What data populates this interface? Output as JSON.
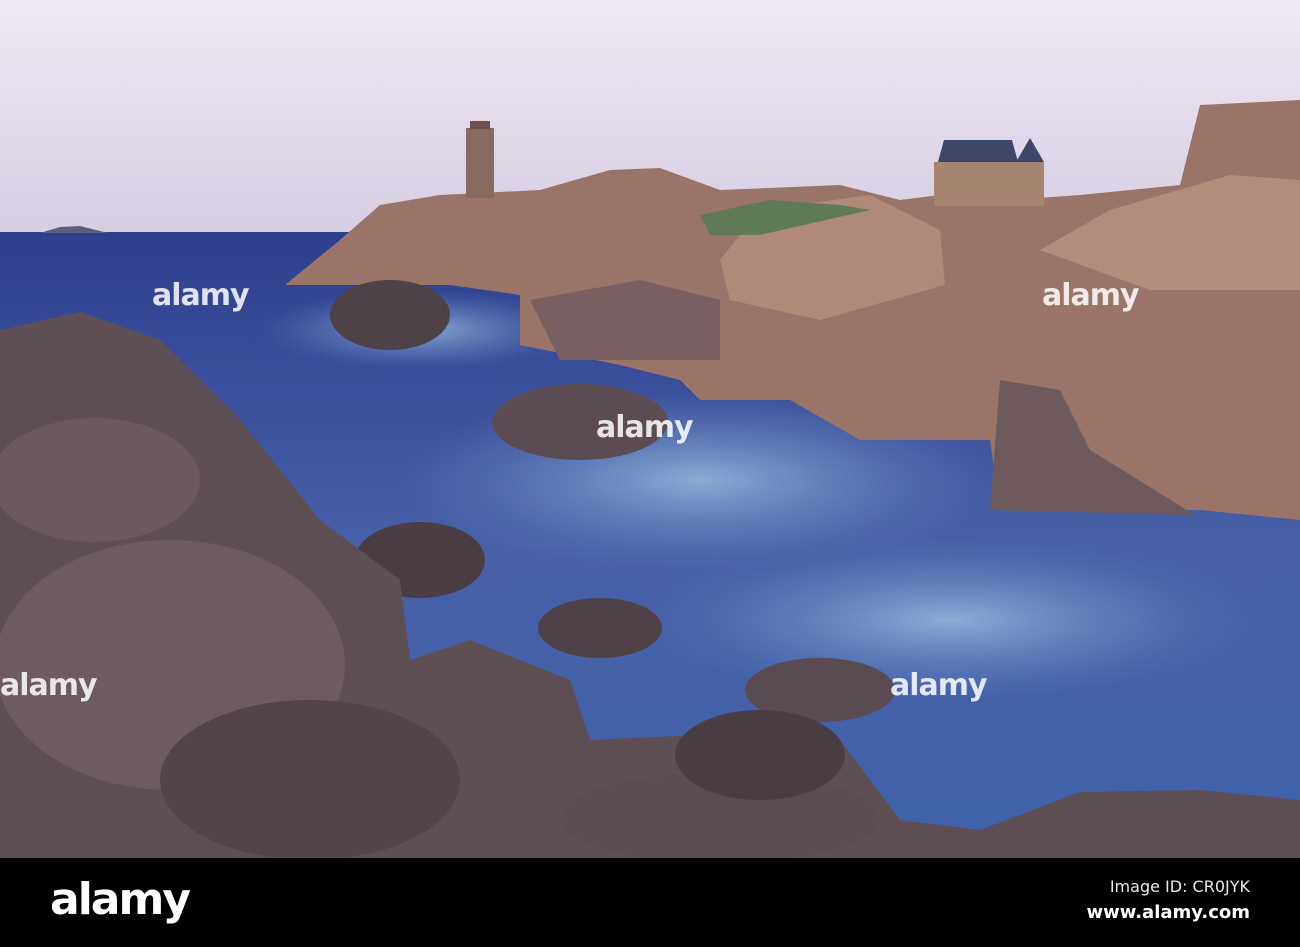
{
  "photo": {
    "subject": "coastal rocks with lighthouse",
    "colors": {
      "sky_top": "#e6dbea",
      "sky_bottom": "#d9cde0",
      "sea": "#3a4f9c",
      "rock_pink": "#a9806f",
      "rock_dark": "#4a3f46"
    }
  },
  "watermark": {
    "text": "alamy"
  },
  "footer": {
    "logo": "alamy",
    "image_id": "Image ID: CR0JYK",
    "website": "www.alamy.com"
  }
}
